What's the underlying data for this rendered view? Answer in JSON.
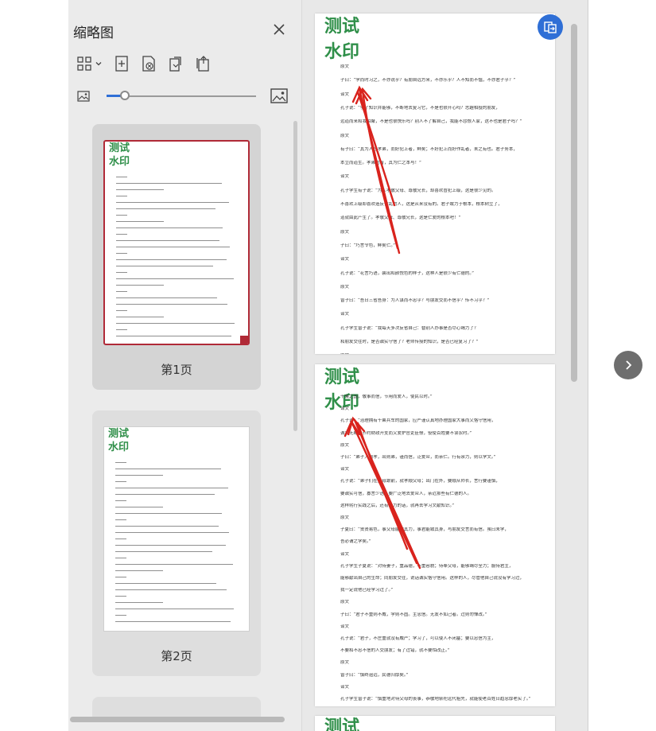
{
  "panel": {
    "title": "缩略图",
    "thumbnails": [
      {
        "label": "第1页",
        "selected": true
      },
      {
        "label": "第2页",
        "selected": false
      }
    ],
    "zoom_level": 0.12
  },
  "watermark": {
    "line1": "测试",
    "line2": "水印"
  },
  "page1_lines": [
    "原文",
    "子曰：“学而时习之，不亦说乎？有朋自远方来，不亦乐乎？人不知而不愠，不亦君子乎？”",
    "译文",
    "孔子说：“学了知识并能够，不断地去复习它，不是也很开心吗？志趣相投的朋友，",
    "远道而来和我相聚，不是也很快乐吗？别人不了解自己，我能不怨恨人家，这不也是君子吗？”",
    "原文",
    "有子曰：“其为人也孝弟，而好犯上者，鲜矣；不好犯上而好作乱者，未之有也。君子务本，",
    "本立而道生。孝弟也者，其为仁之本与！”",
    "译文",
    "孔子学生有子说：“为人孝敬父母、尊敬兄长，却喜欢冒犯上级，这是很少见的。",
    "不喜欢上级却喜欢造反作乱的人，这是从来没有的。君子致力于根本，根本树立了，",
    "道就由此产生了。孝敬父母、尊敬兄长，这是仁爱的根本吧！”",
    "原文",
    "子曰：“巧言令色，鲜矣仁。”",
    "译文",
    "孔子说：“花言巧语，装出和颜悦色的样子，这种人是很少有仁德的。”",
    "原文",
    "曾子曰：“吾日三省吾身：为人谋而不忠乎？与朋友交而不信乎？传不习乎？”",
    "译文",
    "孔子学生曾子说：“我每天多次反省自己：替别人办事是否尽心竭力了？",
    "和朋友交往时，是否诚实守信了？老师传授的知识，是否已经复习了？”",
    "原文"
  ],
  "page2_lines": [
    "千乘之国，敬事而信，节用而爱人，使民以时。”",
    "译文",
    "孔子说：“治理拥有千乘兵车的国家，应严谨认真地办理国家大事而又恪守信用，",
    "诚实无欺，节约财政开支而又爱护官吏臣僚，役使百姓要不误农时。”",
    "原文",
    "子曰：“弟子入则孝，出则弟，谨而信，泛爱众，而亲仁。行有余力，则以学文。”",
    "译文",
    "孔子说：“弟子们在父母跟前，就孝顺父母；出门在外，要顺从师长，言行要谨慎，",
    "要诚实可信，寡言少语，要广泛地去爱众人，亲近那些有仁德的人。",
    "这样躬行实践之后，还有余力的话，就再去学习文献知识。”",
    "原文",
    "子夏曰：“贤贤易色，事父母能竭其力，事君能致其身，与朋友交言而有信。虽曰未学，",
    "吾必谓之学矣。”",
    "译文",
    "孔子学生子夏说：“对待妻子，重品德，不重容貌；侍奉父母，能够竭尽全力；服侍君主，",
    "能够献出自己的生命；同朋友交往，说话诚实恪守信用。这样的人，尽管他自己说没有学习过，",
    "我一定说他已经学习过了。”",
    "原文",
    "子曰：“君子不重则不威，学则不固。主忠信。无友不如己者。过则勿惮改。”",
    "译文",
    "孔子说：“君子，不庄重就没有威严；学习了，可以使人不闭塞；要以忠信为主，",
    "不要和不忠不信的人交朋友；有了过错，就不要怕改正。”",
    "原文",
    "曾子曰：“慎终追远，民德归厚矣。”",
    "译文",
    "孔子学生曾子说：“慎重地对待父母的丧事，恭敬地祭祀远代祖先，就能使老百姓日趋忠厚老实了。”"
  ]
}
